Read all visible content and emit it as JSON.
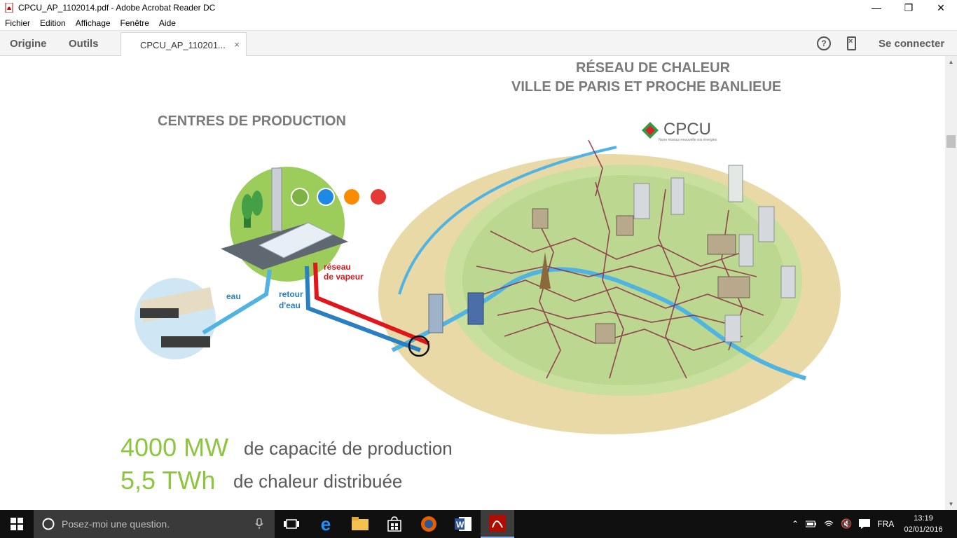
{
  "window": {
    "title": "CPCU_AP_1102014.pdf - Adobe Acrobat Reader DC",
    "controls": {
      "minimize": "—",
      "restore": "❐",
      "close": "✕"
    }
  },
  "menu": [
    "Fichier",
    "Edition",
    "Affichage",
    "Fenêtre",
    "Aide"
  ],
  "toolbar": {
    "home": "Origine",
    "tools": "Outils",
    "doc_tab": "CPCU_AP_110201...",
    "doc_tab_close": "×",
    "help": "?",
    "connect": "Se connecter"
  },
  "page": {
    "title_line1": "RÉSEAU DE CHALEUR",
    "title_line2": "VILLE DE PARIS ET PROCHE BANLIEUE",
    "production_heading": "CENTRES DE PRODUCTION",
    "logo_text": "CPCU",
    "logo_tagline": "Notre réseau renouvelle vos énergies",
    "labels": {
      "eau": "eau",
      "retour1": "retour",
      "retour2": "d'eau",
      "reseau1": "réseau",
      "reseau2": "de vapeur"
    },
    "stat1_value": "4000 MW",
    "stat1_desc": "de capacité de production",
    "stat2_value": "5,5 TWh",
    "stat2_desc": "de chaleur distribuée",
    "colors": {
      "green": "#8cc63f",
      "steam_red": "#e0161b",
      "water_blue": "#2a7ec2",
      "light_blue": "#4fb3e3"
    }
  },
  "taskbar": {
    "search_placeholder": "Posez-moi une question.",
    "language": "FRA",
    "time": "13:19",
    "date": "02/01/2016"
  }
}
